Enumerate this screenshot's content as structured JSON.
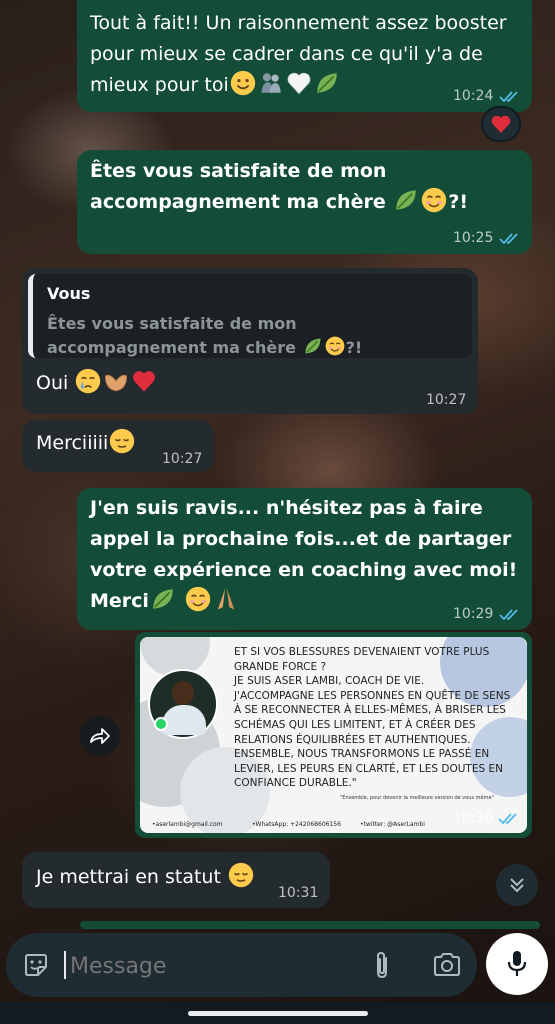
{
  "messages": [
    {
      "id": "m1",
      "direction": "out",
      "text": "Tout à fait!! Un raisonnement assez booster pour mieux se cadrer dans ce qu'il y'a de mieux pour toi",
      "emoji": [
        "smile",
        "family",
        "white-heart",
        "leaf"
      ],
      "time": "10:24",
      "status": "read",
      "reaction": "red-heart"
    },
    {
      "id": "m2",
      "direction": "out",
      "text": "Êtes vous satisfaite de mon accompagnement ma chère",
      "emoji_suffix": "?!",
      "time": "10:25",
      "status": "read"
    },
    {
      "id": "m3",
      "direction": "in",
      "reply_to": {
        "name": "Vous",
        "text": "Êtes vous satisfaite de mon accompagnement ma chère",
        "emoji_suffix": "?!"
      },
      "text": "Oui",
      "time": "10:27"
    },
    {
      "id": "m4",
      "direction": "in",
      "text": "Merciiiii",
      "time": "10:27"
    },
    {
      "id": "m5",
      "direction": "out",
      "text": "J'en suis ravis... n'hésitez pas à faire appel la prochaine fois...et de partager votre expérience en coaching avec moi! Merci",
      "time": "10:29",
      "status": "read"
    },
    {
      "id": "m6",
      "direction": "out",
      "type": "image",
      "time": "10:30",
      "status": "read",
      "poster": {
        "lines": [
          "ET SI VOS BLESSURES DEVENAIENT VOTRE PLUS",
          "GRANDE FORCE ?",
          "JE SUIS ASER LAMBI, COACH DE VIE.",
          "J'ACCOMPAGNE LES PERSONNES EN QUÊTE DE SENS",
          "À SE RECONNECTER À ELLES-MÊMES, À BRISER LES",
          "SCHÉMAS QUI LES LIMITENT, ET À CRÉER DES",
          "RELATIONS ÉQUILIBRÉES ET AUTHENTIQUES.",
          "ENSEMBLE, NOUS TRANSFORMONS LE PASSÉ EN",
          "LEVIER, LES PEURS EN CLARTÉ, ET LES DOUTES EN",
          "CONFIANCE DURABLE.\""
        ],
        "tagline": "\"Ensemble, pour devenir la meilleure version de vous même\"",
        "footer_email": "•aserlambi@gmail.com",
        "footer_whatsapp": "•WhatsApp: +242068606156",
        "footer_twitter": "•twitter: @AserLambi"
      }
    },
    {
      "id": "m7",
      "direction": "in",
      "text": "Je mettrai en statut",
      "time": "10:31"
    }
  ],
  "input": {
    "placeholder": "Message"
  },
  "colors": {
    "outgoing": "#144d37",
    "incoming": "#242b2f",
    "read_tick": "#53bdeb",
    "heart": "#e02d3c"
  },
  "icons": [
    "read-ticks-icon",
    "red-heart-icon",
    "forward-icon",
    "scroll-down-icon",
    "sticker-icon",
    "attach-icon",
    "camera-icon",
    "mic-icon"
  ]
}
